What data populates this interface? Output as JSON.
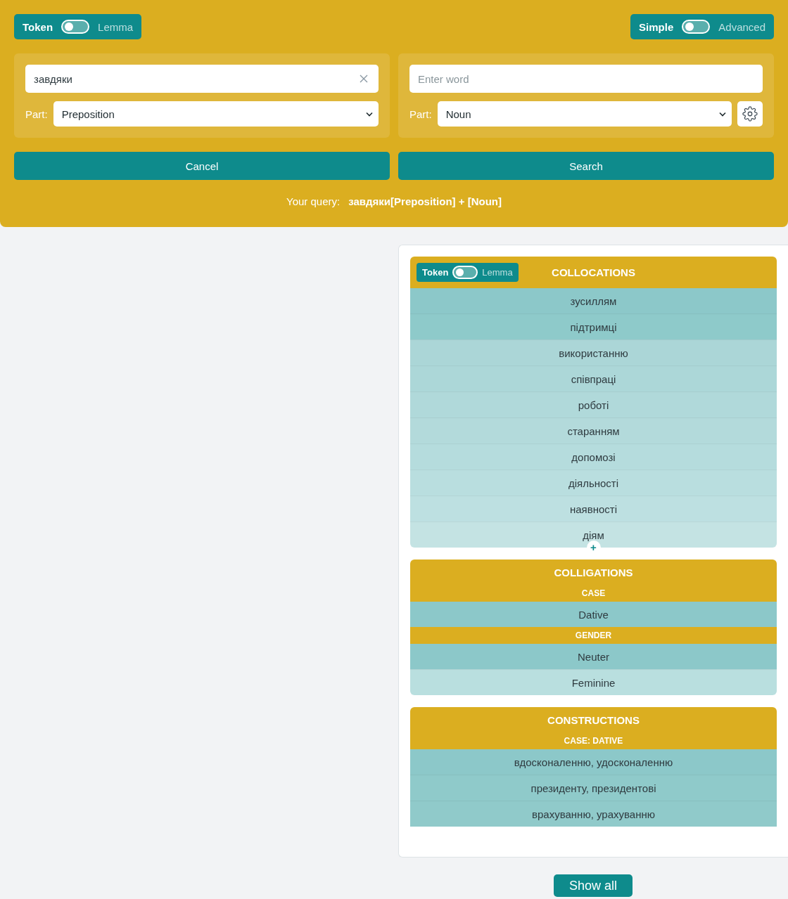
{
  "search": {
    "mode_toggle": {
      "left": "Token",
      "right": "Lemma",
      "on": false
    },
    "view_toggle": {
      "left": "Simple",
      "right": "Advanced",
      "on": false
    },
    "slots": [
      {
        "value": "завдяки",
        "clearable": true,
        "part_label": "Part:",
        "part": "Preposition",
        "settings": false
      },
      {
        "placeholder": "Enter word",
        "clearable": false,
        "part_label": "Part:",
        "part": "Noun",
        "settings": true
      }
    ],
    "buttons": [
      "Cancel",
      "Search"
    ],
    "query": {
      "label": "Your query:",
      "text": "завдяки[Preposition] + [Noun]"
    }
  },
  "results": {
    "collocations": {
      "toggle": {
        "left": "Token",
        "right": "Lemma",
        "on": false
      },
      "title": "COLLOCATIONS",
      "rows": [
        {
          "text": "зусиллям",
          "color": "#8cc8c9"
        },
        {
          "text": "підтримці",
          "color": "#8ecaca"
        },
        {
          "text": "використанню",
          "color": "#abd6d7"
        },
        {
          "text": "співпраці",
          "color": "#acd7d8"
        },
        {
          "text": "роботі",
          "color": "#b0d9da"
        },
        {
          "text": "старанням",
          "color": "#b3dadb"
        },
        {
          "text": "допомозі",
          "color": "#b5dcdd"
        },
        {
          "text": "діяльності",
          "color": "#b9dedf"
        },
        {
          "text": "наявності",
          "color": "#bde0e1"
        },
        {
          "text": "діям",
          "color": "#c4e3e3"
        }
      ],
      "more": "+"
    },
    "colligations": {
      "title": "COLLIGATIONS",
      "groups": [
        {
          "heading": "CASE",
          "rows": [
            {
              "text": "Dative",
              "color": "#8cc8c9"
            }
          ]
        },
        {
          "heading": "GENDER",
          "rows": [
            {
              "text": "Neuter",
              "color": "#8cc8c9"
            },
            {
              "text": "Feminine",
              "color": "#b9dfdf"
            }
          ]
        }
      ]
    },
    "constructions": {
      "title": "CONSTRUCTIONS",
      "groups": [
        {
          "heading": "CASE: DATIVE",
          "rows": [
            {
              "text": "вдосконаленню, удосконаленню",
              "color": "#8cc8c9"
            },
            {
              "text": "президенту, президентові",
              "color": "#8fcaca"
            },
            {
              "text": "врахуванню, урахуванню",
              "color": "#90caca"
            }
          ]
        }
      ]
    }
  },
  "show_all": "Show all"
}
